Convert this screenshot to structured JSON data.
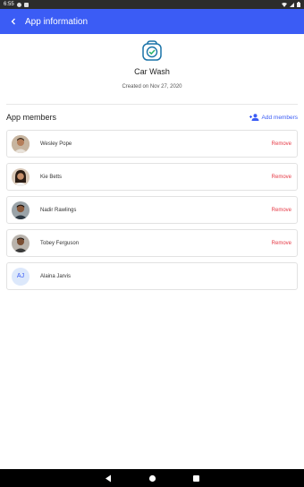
{
  "status_bar": {
    "time": "6:55"
  },
  "app_bar": {
    "title": "App information"
  },
  "app": {
    "name": "Car Wash",
    "created": "Created on Nov 27, 2020"
  },
  "members_section": {
    "title": "App members",
    "add_label": "Add members"
  },
  "members": [
    {
      "name": "Wesley Pope",
      "action": "Remove"
    },
    {
      "name": "Kie Betts",
      "action": "Remove"
    },
    {
      "name": "Nadir Rawlings",
      "action": "Remove"
    },
    {
      "name": "Tobey Ferguson",
      "action": "Remove"
    },
    {
      "name": "Alaina Jarvis",
      "initials": "AJ"
    }
  ],
  "colors": {
    "accent": "#3b5cf5",
    "danger": "#e53945",
    "app_icon": "#1a73a8"
  }
}
